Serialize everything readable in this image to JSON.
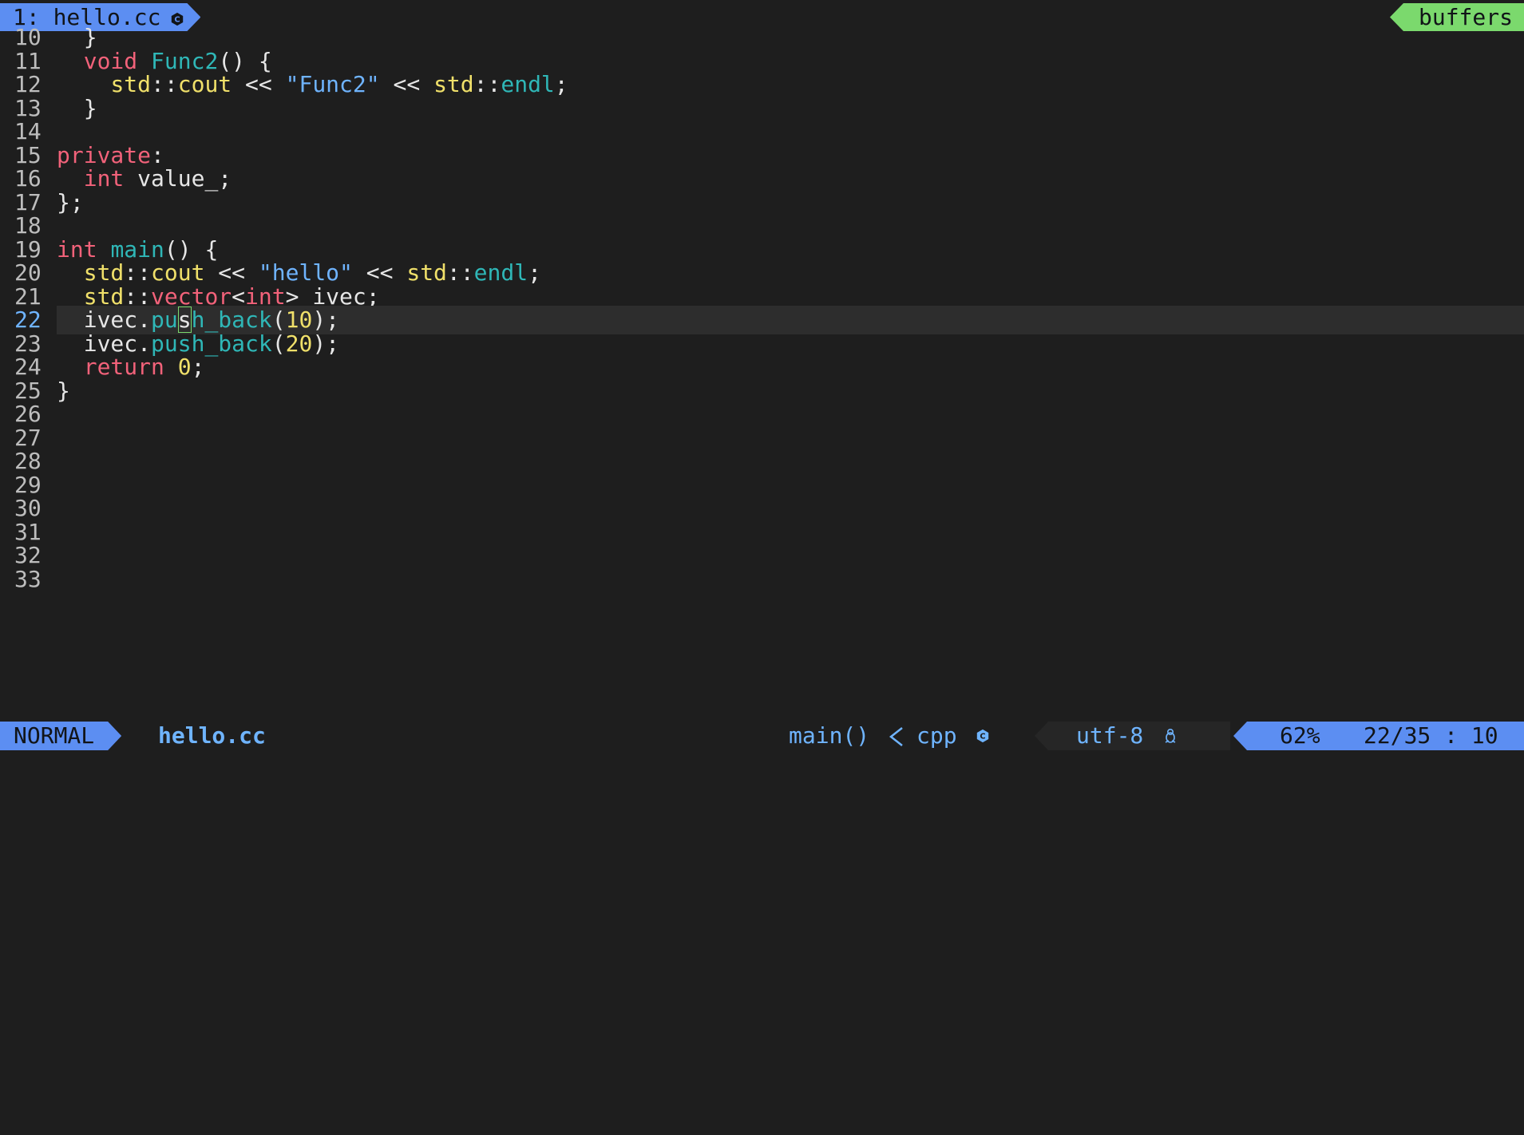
{
  "tabline": {
    "active_tab": "1: hello.cc",
    "active_tab_icon": "cpp-file-icon",
    "buffers_label": "buffers"
  },
  "editor": {
    "language": "cpp",
    "current_line": 22,
    "lines": [
      {
        "num": "10",
        "tokens": [
          {
            "t": "  }",
            "c": "pl"
          }
        ]
      },
      {
        "num": "11",
        "tokens": [
          {
            "t": "  ",
            "c": "pl"
          },
          {
            "t": "void",
            "c": "kw"
          },
          {
            "t": " ",
            "c": "pl"
          },
          {
            "t": "Func2",
            "c": "fn"
          },
          {
            "t": "() {",
            "c": "pl"
          }
        ]
      },
      {
        "num": "12",
        "tokens": [
          {
            "t": "    ",
            "c": "pl"
          },
          {
            "t": "std",
            "c": "ns"
          },
          {
            "t": "::",
            "c": "pl"
          },
          {
            "t": "cout",
            "c": "ns"
          },
          {
            "t": " << ",
            "c": "pl"
          },
          {
            "t": "\"Func2\"",
            "c": "str"
          },
          {
            "t": " << ",
            "c": "pl"
          },
          {
            "t": "std",
            "c": "ns"
          },
          {
            "t": "::",
            "c": "pl"
          },
          {
            "t": "endl",
            "c": "fn"
          },
          {
            "t": ";",
            "c": "pl"
          }
        ]
      },
      {
        "num": "13",
        "tokens": [
          {
            "t": "  }",
            "c": "pl"
          }
        ]
      },
      {
        "num": "14",
        "tokens": []
      },
      {
        "num": "15",
        "tokens": [
          {
            "t": "private",
            "c": "kw"
          },
          {
            "t": ":",
            "c": "pl"
          }
        ]
      },
      {
        "num": "16",
        "tokens": [
          {
            "t": "  ",
            "c": "pl"
          },
          {
            "t": "int",
            "c": "kw"
          },
          {
            "t": " value_;",
            "c": "pl"
          }
        ]
      },
      {
        "num": "17",
        "tokens": [
          {
            "t": "};",
            "c": "pl"
          }
        ]
      },
      {
        "num": "18",
        "tokens": []
      },
      {
        "num": "19",
        "tokens": [
          {
            "t": "int",
            "c": "kw"
          },
          {
            "t": " ",
            "c": "pl"
          },
          {
            "t": "main",
            "c": "fn"
          },
          {
            "t": "() {",
            "c": "pl"
          }
        ]
      },
      {
        "num": "20",
        "tokens": [
          {
            "t": "  ",
            "c": "pl"
          },
          {
            "t": "std",
            "c": "ns"
          },
          {
            "t": "::",
            "c": "pl"
          },
          {
            "t": "cout",
            "c": "ns"
          },
          {
            "t": " << ",
            "c": "pl"
          },
          {
            "t": "\"hello\"",
            "c": "str"
          },
          {
            "t": " << ",
            "c": "pl"
          },
          {
            "t": "std",
            "c": "ns"
          },
          {
            "t": "::",
            "c": "pl"
          },
          {
            "t": "endl",
            "c": "fn"
          },
          {
            "t": ";",
            "c": "pl"
          }
        ]
      },
      {
        "num": "21",
        "tokens": [
          {
            "t": "  ",
            "c": "pl"
          },
          {
            "t": "std",
            "c": "ns"
          },
          {
            "t": "::",
            "c": "pl"
          },
          {
            "t": "vector",
            "c": "kw"
          },
          {
            "t": "<",
            "c": "pl"
          },
          {
            "t": "int",
            "c": "kw"
          },
          {
            "t": "> ivec;",
            "c": "pl"
          }
        ]
      },
      {
        "num": "22",
        "tokens": [
          {
            "t": "  ivec.",
            "c": "pl"
          },
          {
            "t": "pu",
            "c": "fn"
          },
          {
            "t": "s",
            "c": "cursor"
          },
          {
            "t": "h_back",
            "c": "fn"
          },
          {
            "t": "(",
            "c": "pl"
          },
          {
            "t": "10",
            "c": "num"
          },
          {
            "t": ");",
            "c": "pl"
          }
        ]
      },
      {
        "num": "23",
        "tokens": [
          {
            "t": "  ivec.",
            "c": "pl"
          },
          {
            "t": "push_back",
            "c": "fn"
          },
          {
            "t": "(",
            "c": "pl"
          },
          {
            "t": "20",
            "c": "num"
          },
          {
            "t": ");",
            "c": "pl"
          }
        ]
      },
      {
        "num": "24",
        "tokens": [
          {
            "t": "  ",
            "c": "pl"
          },
          {
            "t": "return",
            "c": "kw"
          },
          {
            "t": " ",
            "c": "pl"
          },
          {
            "t": "0",
            "c": "num"
          },
          {
            "t": ";",
            "c": "pl"
          }
        ]
      },
      {
        "num": "25",
        "tokens": [
          {
            "t": "}",
            "c": "pl"
          }
        ]
      },
      {
        "num": "26",
        "tokens": []
      },
      {
        "num": "27",
        "tokens": []
      },
      {
        "num": "28",
        "tokens": []
      },
      {
        "num": "29",
        "tokens": []
      },
      {
        "num": "30",
        "tokens": []
      },
      {
        "num": "31",
        "tokens": []
      },
      {
        "num": "32",
        "tokens": []
      },
      {
        "num": "33",
        "tokens": []
      }
    ]
  },
  "statusline": {
    "mode": "NORMAL",
    "filename": "hello.cc",
    "function": "main()",
    "filetype": "cpp",
    "filetype_icon": "cpp-file-icon",
    "encoding": "utf-8",
    "os_icon": "linux-tux-icon",
    "percent": "62%",
    "position": "22/35 : 10"
  },
  "colors": {
    "background": "#1e1e1e",
    "current_line": "#2d2d2d",
    "accent_blue": "#5c8ef2",
    "accent_green": "#7bd96d",
    "keyword": "#f2627a",
    "function": "#2fb7b7",
    "namespace": "#f0e06a",
    "string": "#6fb4ff"
  }
}
